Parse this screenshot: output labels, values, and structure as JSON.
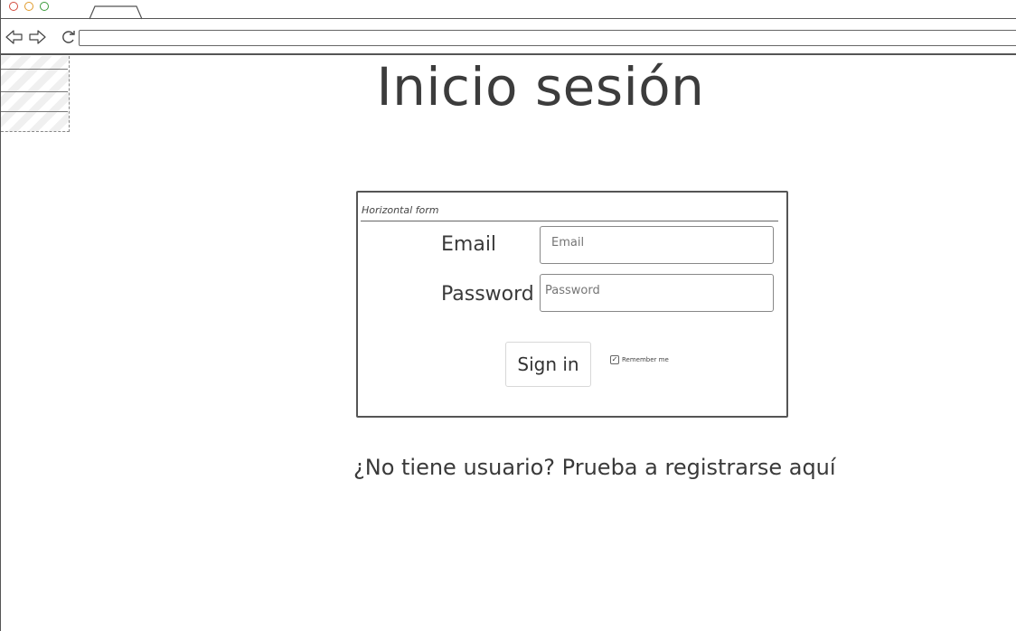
{
  "page": {
    "title": "Inicio sesión"
  },
  "form": {
    "legend": "Horizontal form",
    "email_label": "Email",
    "email_placeholder": "Email",
    "password_label": "Password",
    "password_placeholder": "Password",
    "signin_label": "Sign in",
    "remember_label": "Remember me",
    "remember_checked": true
  },
  "register": {
    "text": "¿No tiene usuario? Prueba a registrarse aquí"
  },
  "icons": {
    "back": "back-arrow-icon",
    "forward": "forward-arrow-icon",
    "reload": "reload-icon",
    "checkbox": "checkmark-icon"
  },
  "colors": {
    "close_dot": "#d24a3c",
    "minimize_dot": "#e09a2a",
    "maximize_dot": "#3a9a3a",
    "ink": "#3a3a3a"
  }
}
